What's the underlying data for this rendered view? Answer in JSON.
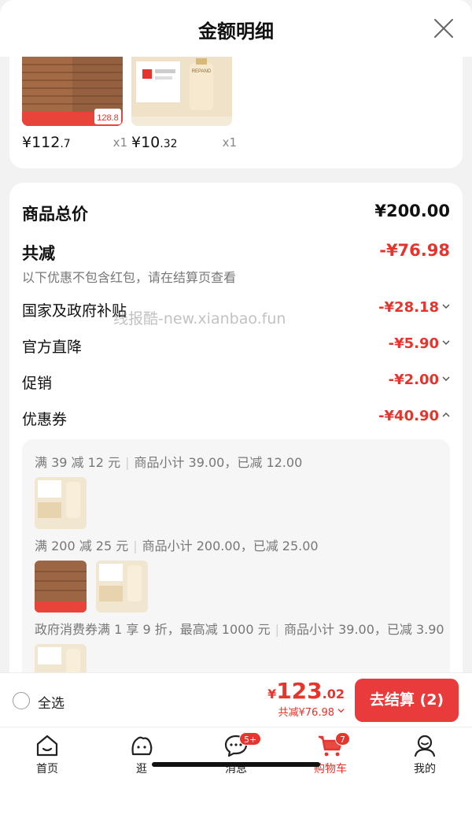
{
  "header": {
    "title": "金额明细"
  },
  "products": [
    {
      "price_int": "¥112",
      "price_dec": ".7",
      "qty": "x1",
      "thumb_tag": "128.8"
    },
    {
      "price_int": "¥10",
      "price_dec": ".32",
      "qty": "x1",
      "thumb_tag": "REPAND"
    }
  ],
  "summary": {
    "total_label": "商品总价",
    "total_value": "¥200.00",
    "discount_label": "共减",
    "discount_value": "-¥76.98",
    "note": "以下优惠不包含红包，请在结算页查看",
    "items": [
      {
        "label": "国家及政府补贴",
        "value": "-¥28.18",
        "chevron": "chevron-down"
      },
      {
        "label": "官方直降",
        "value": "-¥5.90",
        "chevron": "chevron-down"
      },
      {
        "label": "促销",
        "value": "-¥2.00",
        "chevron": "chevron-down"
      },
      {
        "label": "优惠券",
        "value": "-¥40.90",
        "chevron": "chevron-up"
      }
    ]
  },
  "coupons": [
    {
      "rule": "满 39 减 12 元",
      "detail": "商品小计 39.00，已减 12.00"
    },
    {
      "rule": "满 200 减 25 元",
      "detail": "商品小计 200.00，已减 25.00"
    },
    {
      "rule": "政府消费券满 1 享 9 折，最高减 1000 元",
      "detail": "商品小计 39.00，已减 3.90"
    }
  ],
  "watermark": "线报酷-new.xianbao.fun",
  "footer": {
    "select_all": "全选",
    "total_currency": "¥",
    "total_int": "123",
    "total_dec": ".02",
    "total_saved": "共减¥76.98",
    "checkout": "去结算 (2)"
  },
  "tabs": [
    {
      "label": "首页",
      "icon": "home-icon"
    },
    {
      "label": "逛",
      "icon": "browse-icon"
    },
    {
      "label": "消息",
      "icon": "message-icon",
      "badge": "5+"
    },
    {
      "label": "购物车",
      "icon": "cart-icon",
      "badge": "7"
    },
    {
      "label": "我的",
      "icon": "profile-icon"
    }
  ],
  "colors": {
    "accent": "#e5352c",
    "checkout_bg": "#e93b3b",
    "panel": "#f6f6f6"
  }
}
